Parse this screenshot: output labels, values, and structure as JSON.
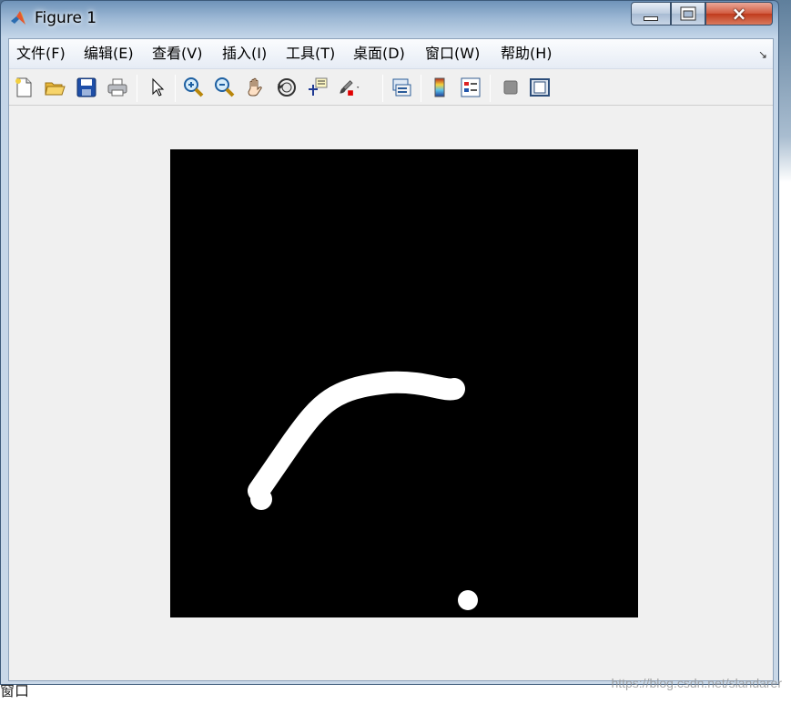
{
  "window": {
    "title": "Figure 1",
    "icon": "matlab-icon",
    "controls": {
      "minimize": "minimize-icon",
      "maximize": "maximize-icon",
      "close": "×"
    }
  },
  "menubar": {
    "items": [
      "文件(F)",
      "编辑(E)",
      "查看(V)",
      "插入(I)",
      "工具(T)",
      "桌面(D)",
      "窗口(W)",
      "帮助(H)"
    ],
    "dock_arrow": "↘"
  },
  "toolbar": {
    "buttons": [
      "new-figure-icon",
      "open-file-icon",
      "save-icon",
      "print-icon",
      "edit-plot-arrow-icon",
      "zoom-in-icon",
      "zoom-out-icon",
      "pan-hand-icon",
      "rotate-3d-icon",
      "data-cursor-icon",
      "brush-icon",
      "link-plot-icon",
      "colorbar-icon",
      "legend-icon",
      "hide-plot-tools-icon",
      "show-plot-tools-icon"
    ]
  },
  "figure": {
    "background": "#000000",
    "stroke_color": "#ffffff"
  },
  "desktop": {
    "behind_text": "窗口",
    "watermark": "https://blog.csdn.net/slandarer"
  }
}
